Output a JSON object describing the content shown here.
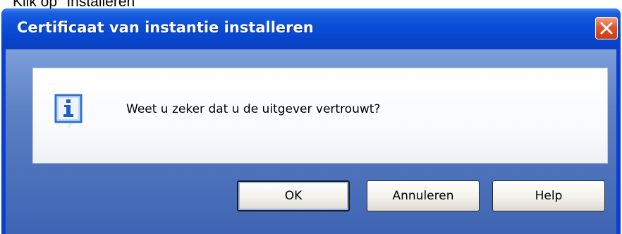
{
  "caption": "Klik op \"Installeren\"",
  "window": {
    "title": "Certificaat van instantie installeren",
    "close_icon": "close-icon"
  },
  "message": {
    "icon": "info-icon",
    "text": "Weet u zeker dat u de uitgever vertrouwt?"
  },
  "buttons": {
    "ok_label": "OK",
    "cancel_label": "Annuleren",
    "help_label": "Help"
  },
  "colors": {
    "titlebar": "#0a4fd6",
    "client_background": "#5a7fc4",
    "close_button": "#e0552c"
  }
}
